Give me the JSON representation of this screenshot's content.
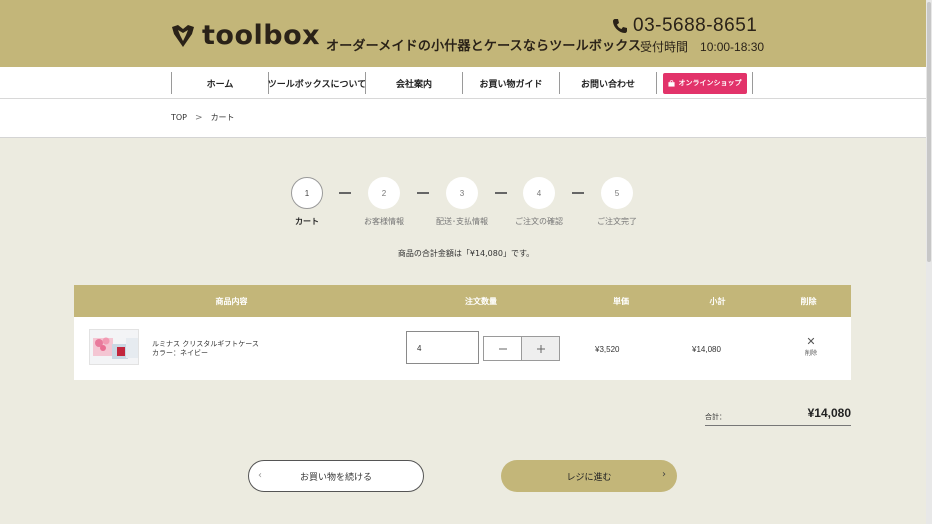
{
  "header": {
    "logo_text": "toolbox",
    "tagline": "オーダーメイドの小什器とケースならツールボックス",
    "phone": "03-5688-8651",
    "hours_label": "受付時間",
    "hours_value": "10:00-18:30",
    "band_color": "#c3b679"
  },
  "nav": {
    "items": [
      "ホーム",
      "ツールボックスについて",
      "会社案内",
      "お買い物ガイド",
      "お問い合わせ"
    ],
    "shop_button": "オンラインショップ",
    "shop_color": "#e2336a"
  },
  "breadcrumb": {
    "top": "TOP",
    "current": "カート"
  },
  "steps": [
    {
      "num": "1",
      "label": "カート",
      "active": true
    },
    {
      "num": "2",
      "label": "お客様情報",
      "active": false
    },
    {
      "num": "3",
      "label": "配送･支払情報",
      "active": false
    },
    {
      "num": "4",
      "label": "ご注文の確認",
      "active": false
    },
    {
      "num": "5",
      "label": "ご注文完了",
      "active": false
    }
  ],
  "total_message": "商品の合計金額は「¥14,080」です。",
  "cart": {
    "headers": {
      "item": "商品内容",
      "qty": "注文数量",
      "unit": "単価",
      "subtotal": "小計",
      "delete": "削除"
    },
    "rows": [
      {
        "name": "ルミナス クリスタルギフトケース",
        "variant": "カラー：ネイビー",
        "qty": "4",
        "unit_price": "¥3,520",
        "subtotal": "¥14,080",
        "delete_label": "削除"
      }
    ]
  },
  "summary": {
    "label": "合計：",
    "value": "¥14,080"
  },
  "buttons": {
    "continue": "お買い物を続ける",
    "register": "レジに進む"
  }
}
